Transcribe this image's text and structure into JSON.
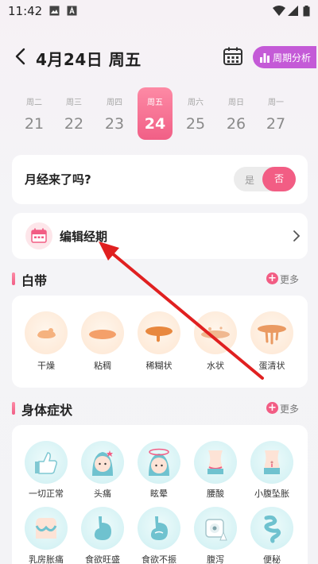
{
  "status_bar": {
    "time": "11:42"
  },
  "header": {
    "date": "4月24日 周五",
    "period_analysis_label": "周期分析"
  },
  "week": [
    {
      "weekday": "周二",
      "day": "21"
    },
    {
      "weekday": "周三",
      "day": "22"
    },
    {
      "weekday": "周四",
      "day": "23"
    },
    {
      "weekday": "周五",
      "day": "24",
      "selected": true
    },
    {
      "weekday": "周六",
      "day": "25"
    },
    {
      "weekday": "周日",
      "day": "26"
    },
    {
      "weekday": "周一",
      "day": "27"
    }
  ],
  "period_question": {
    "text": "月经来了吗?",
    "yes": "是",
    "no": "否",
    "selected": "否"
  },
  "edit_period": {
    "label": "编辑经期"
  },
  "discharge": {
    "title": "白带",
    "more": "更多",
    "items": [
      {
        "label": "干燥"
      },
      {
        "label": "粘稠"
      },
      {
        "label": "稀糊状"
      },
      {
        "label": "水状"
      },
      {
        "label": "蛋清状"
      }
    ]
  },
  "symptoms": {
    "title": "身体症状",
    "more": "更多",
    "items": [
      {
        "label": "一切正常"
      },
      {
        "label": "头痛"
      },
      {
        "label": "眩晕"
      },
      {
        "label": "腰酸"
      },
      {
        "label": "小腹坠胀"
      },
      {
        "label": "乳房胀痛"
      },
      {
        "label": "食欲旺盛"
      },
      {
        "label": "食欲不振"
      },
      {
        "label": "腹泻"
      },
      {
        "label": "便秘"
      }
    ]
  },
  "colors": {
    "accent_pink": "#f25d84",
    "purple_button": "#c45ad7",
    "annotation_arrow": "#e02020"
  }
}
